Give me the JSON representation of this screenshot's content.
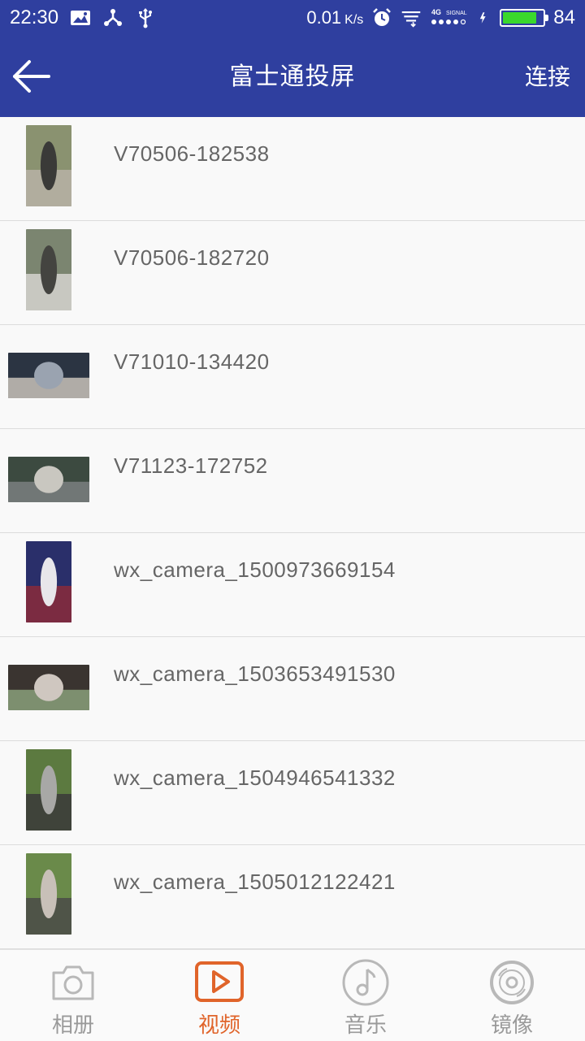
{
  "status_bar": {
    "time": "22:30",
    "speed": "0.01",
    "speed_unit": "K/s",
    "network": "4G",
    "signal": "SIGNAL",
    "battery_percent": "84",
    "battery_level": 0.84,
    "icons": [
      "image-icon",
      "share-icon",
      "usb-icon",
      "alarm-icon",
      "download-icon",
      "signal-icon",
      "charging-icon",
      "battery-icon"
    ]
  },
  "header": {
    "back_icon": "back-arrow-icon",
    "title": "富士通投屏",
    "connect_label": "连接"
  },
  "videos": [
    {
      "name": "V70506-182538",
      "orientation": "portrait",
      "palette": [
        "#8a9270",
        "#3a3a38",
        "#b7b2a6"
      ]
    },
    {
      "name": "V70506-182720",
      "orientation": "portrait",
      "palette": [
        "#7b8570",
        "#444440",
        "#d6d3cf"
      ]
    },
    {
      "name": "V71010-134420",
      "orientation": "landscape",
      "palette": [
        "#2b3442",
        "#9aa3b0",
        "#c8c2b8"
      ]
    },
    {
      "name": "V71123-172752",
      "orientation": "landscape",
      "palette": [
        "#3c4a40",
        "#c9c7c0",
        "#7a7f80"
      ]
    },
    {
      "name": "wx_camera_1500973669154",
      "orientation": "portrait",
      "palette": [
        "#2a2f6a",
        "#e8e6ea",
        "#8a2a3a"
      ]
    },
    {
      "name": "wx_camera_1503653491530",
      "orientation": "landscape",
      "palette": [
        "#3a3430",
        "#cfc7c0",
        "#8aa07a"
      ]
    },
    {
      "name": "wx_camera_1504946541332",
      "orientation": "portrait",
      "palette": [
        "#5c7a40",
        "#a8a8a6",
        "#3a3a3a"
      ]
    },
    {
      "name": "wx_camera_1505012122421",
      "orientation": "portrait",
      "palette": [
        "#6a8a4a",
        "#c8c0b8",
        "#4a4a48"
      ]
    }
  ],
  "tabs": [
    {
      "label": "相册",
      "icon": "camera-icon",
      "active": false
    },
    {
      "label": "视频",
      "icon": "video-play-icon",
      "active": true
    },
    {
      "label": "音乐",
      "icon": "music-note-icon",
      "active": false
    },
    {
      "label": "镜像",
      "icon": "disc-mirror-icon",
      "active": false
    }
  ],
  "colors": {
    "primary": "#2f3f9f",
    "accent": "#e0642a",
    "tab_inactive": "#9a9a9a"
  }
}
